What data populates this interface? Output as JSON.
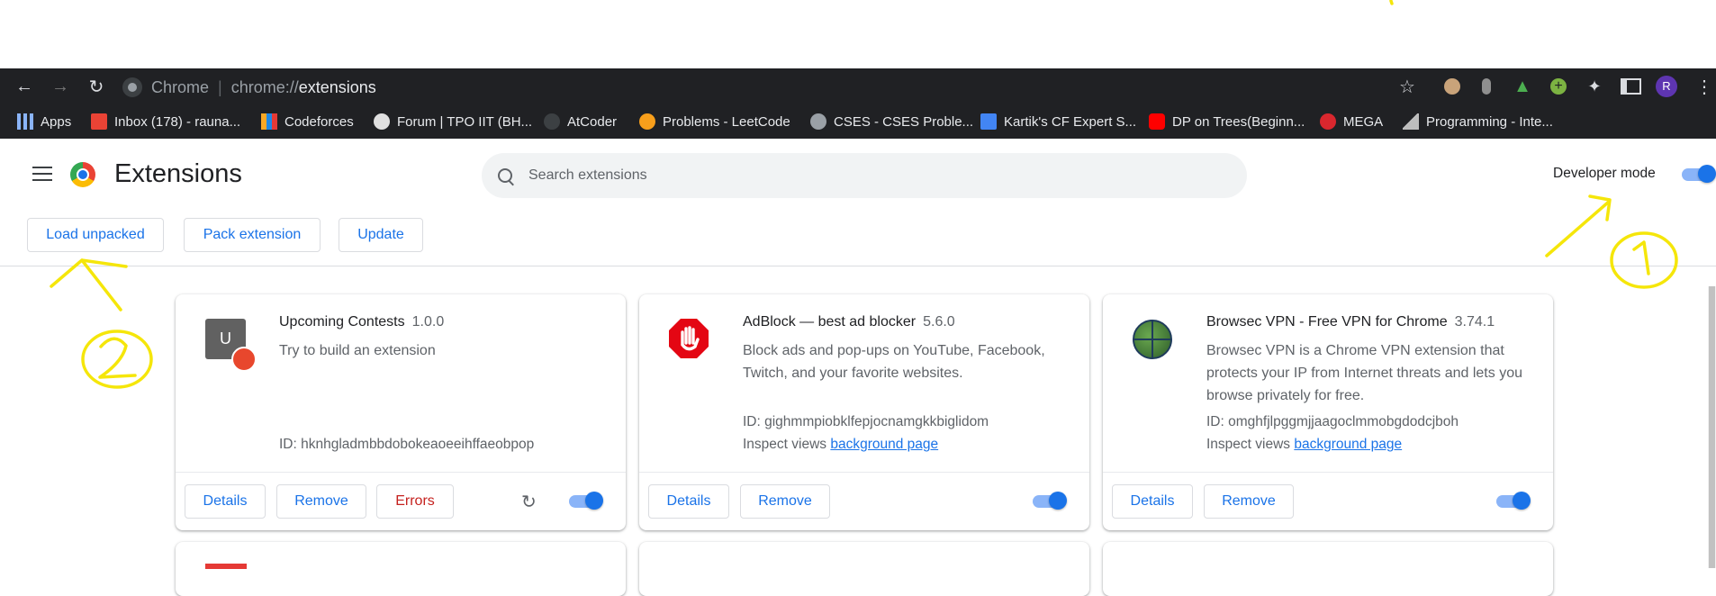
{
  "browser": {
    "omnibox": {
      "site": "Chrome",
      "url_prefix": "chrome://",
      "url_path": "extensions"
    },
    "profile_initial": "R",
    "bookmarks": [
      {
        "label": "Apps",
        "icon": "apps-grid-icon"
      },
      {
        "label": "Inbox (178) - rauna...",
        "icon": "gmail-icon"
      },
      {
        "label": "Codeforces",
        "icon": "codeforces-icon"
      },
      {
        "label": "Forum | TPO IIT (BH...",
        "icon": "forum-icon"
      },
      {
        "label": "AtCoder",
        "icon": "atcoder-icon"
      },
      {
        "label": "Problems - LeetCode",
        "icon": "leetcode-icon"
      },
      {
        "label": "CSES - CSES Proble...",
        "icon": "globe-icon"
      },
      {
        "label": "Kartik's CF Expert S...",
        "icon": "docs-icon"
      },
      {
        "label": "DP on Trees(Beginn...",
        "icon": "youtube-icon"
      },
      {
        "label": "MEGA",
        "icon": "mega-icon"
      },
      {
        "label": "Programming - Inte...",
        "icon": "mountain-icon"
      }
    ]
  },
  "header": {
    "title": "Extensions",
    "search_placeholder": "Search extensions",
    "developer_mode_label": "Developer mode",
    "developer_mode_on": true
  },
  "dev_toolbar": {
    "load_unpacked": "Load unpacked",
    "pack_extension": "Pack extension",
    "update": "Update"
  },
  "extensions": [
    {
      "name": "Upcoming Contests",
      "version": "1.0.0",
      "description": "Try to build an extension",
      "id_text": "ID: hknhgladmbbdobokeaoeeihffaeobpop",
      "enabled": true,
      "buttons": {
        "details": "Details",
        "remove": "Remove",
        "errors": "Errors"
      }
    },
    {
      "name": "AdBlock — best ad blocker",
      "version": "5.6.0",
      "description": "Block ads and pop-ups on YouTube, Facebook, Twitch, and your favorite websites.",
      "id_text": "ID: gighmmpiobklfepjocnamgkkbiglidom",
      "inspect_label": "Inspect views",
      "inspect_link": "background page",
      "enabled": true,
      "buttons": {
        "details": "Details",
        "remove": "Remove"
      }
    },
    {
      "name": "Browsec VPN - Free VPN for Chrome",
      "version": "3.74.1",
      "description": "Browsec VPN is a Chrome VPN extension that protects your IP from Internet threats and lets you browse privately for free.",
      "id_text": "ID: omghfjlpggmjjaagoclmmobgdodcjboh",
      "inspect_label": "Inspect views",
      "inspect_link": "background page",
      "enabled": true,
      "buttons": {
        "details": "Details",
        "remove": "Remove"
      }
    }
  ],
  "annotations": {
    "marker_1": "1",
    "marker_2": "2"
  },
  "colors": {
    "accent": "#1a73e8",
    "toolbar": "#202124",
    "errors": "#c5221f",
    "annotation": "#f5e60a"
  }
}
